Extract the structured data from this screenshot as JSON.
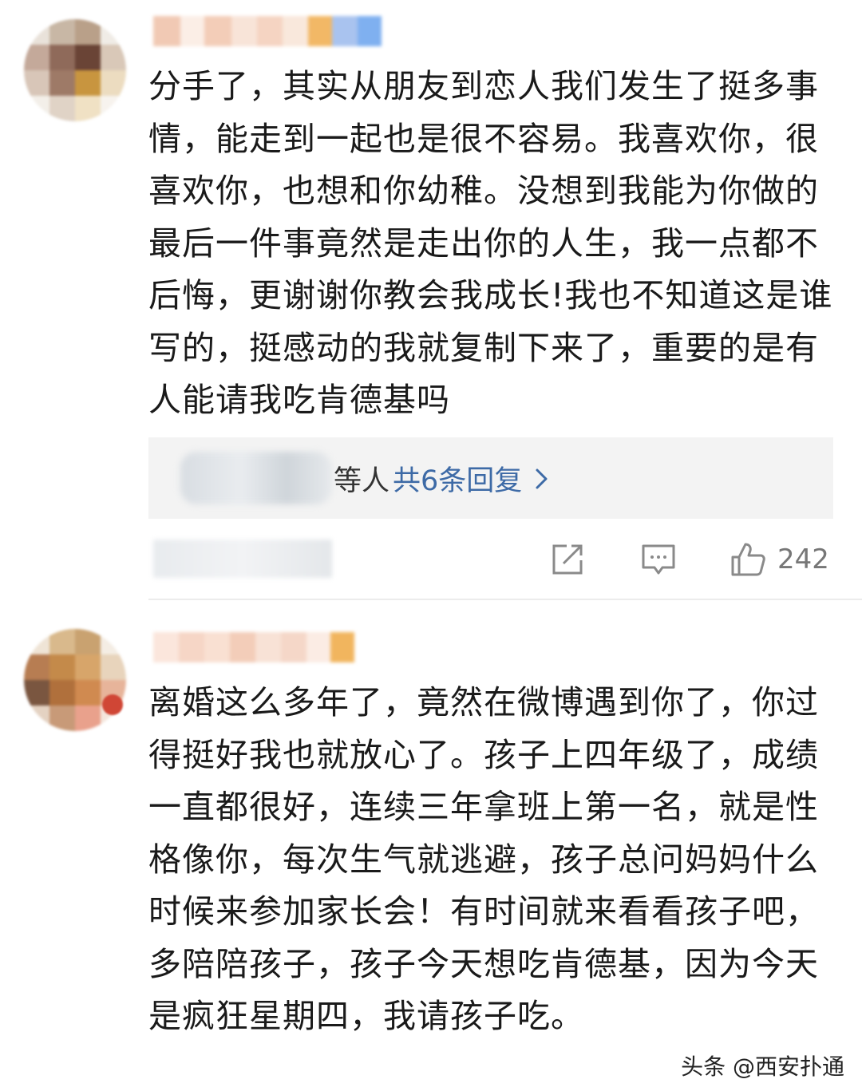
{
  "comments": [
    {
      "text": "分手了，其实从朋友到恋人我们发生了挺多事情，能走到一起也是很不容易。我喜欢你，很喜欢你，也想和你幼稚。没想到我能为你做的最后一件事竟然是走出你的人生，我一点都不后悔，更谢谢你教会我成长!我也不知道这是谁写的，挺感动的我就复制下来了，重要的是有人能请我吃肯德基吗",
      "reply_suffix": "等人",
      "reply_link": "共6条回复",
      "like_count": "242"
    },
    {
      "text": "离婚这么多年了，竟然在微博遇到你了，你过得挺好我也就放心了。孩子上四年级了，成绩一直都很好，连续三年拿班上第一名，就是性格像你，每次生气就逃避，孩子总问妈妈什么时候来参加家长会！有时间就来看看孩子吧，多陪陪孩子，孩子今天想吃肯德基，因为今天是疯狂星期四，我请孩子吃。"
    }
  ],
  "watermark": "头条 @西安扑通",
  "icons": {
    "share": "share-icon",
    "comment": "comment-icon",
    "like": "like-icon",
    "chevron": "chevron-right-icon"
  },
  "colors": {
    "link": "#3d6aa6",
    "reply_bg": "#f3f3f3",
    "meta_text": "#777777"
  }
}
